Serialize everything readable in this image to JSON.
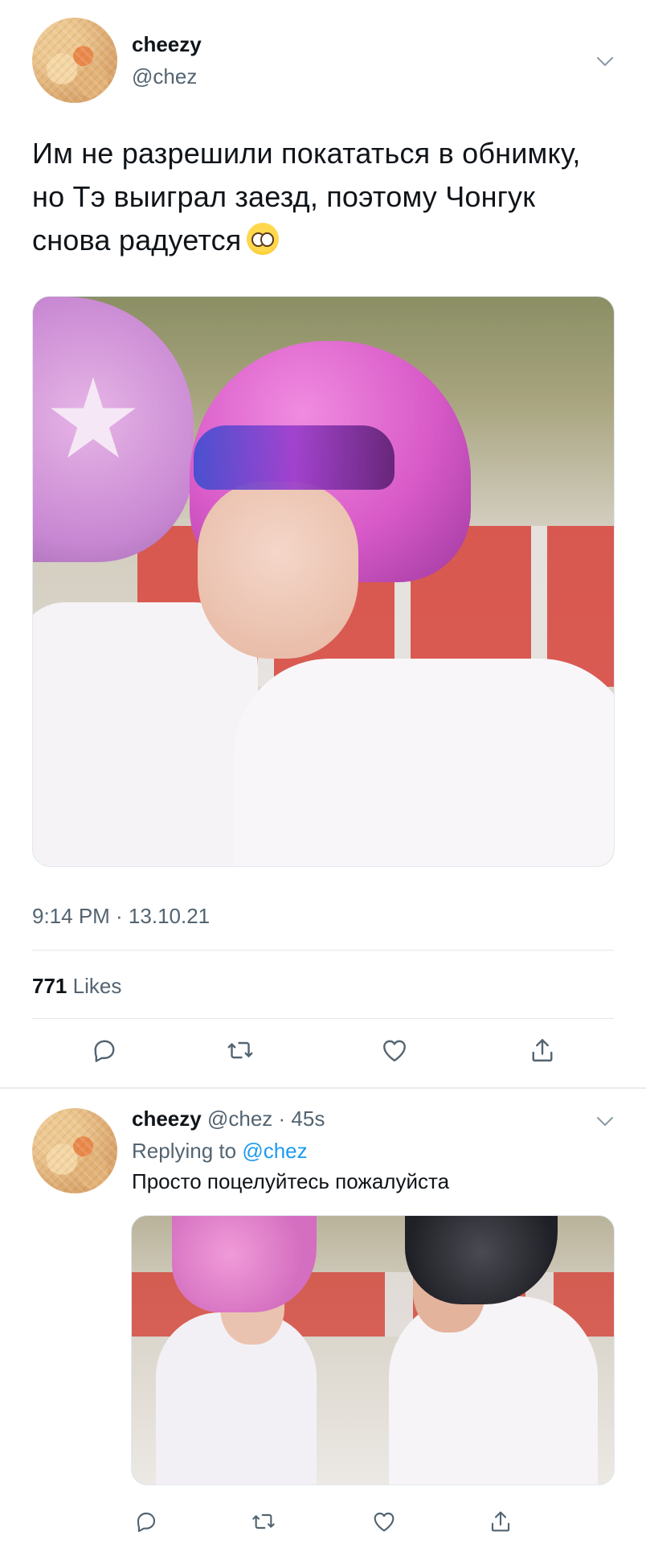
{
  "main_tweet": {
    "author_name": "cheezy",
    "author_handle": "@chez",
    "text": "Им не разрешили покататься в обнимку, но Тэ выиграл заезд, поэтому Чонгук снова радуется",
    "emoji": "pleading-face-emoji",
    "timestamp": "9:14 PM · 13.10.21",
    "likes_count": "771",
    "likes_label": "Likes"
  },
  "reply_tweet": {
    "author_name": "cheezy",
    "author_handle": "@chez",
    "time_ago": "· 45s",
    "replying_prefix": "Replying to",
    "replying_to": "@chez",
    "text": "Просто поцелуйтесь пожалуйста"
  },
  "actions": {
    "reply_icon": "reply-icon",
    "retweet_icon": "retweet-icon",
    "like_icon": "like-icon",
    "share_icon": "share-icon"
  },
  "colors": {
    "text_primary": "#0f1419",
    "text_secondary": "#536471",
    "link": "#1d9bf0",
    "divider": "#e1e8ed"
  }
}
